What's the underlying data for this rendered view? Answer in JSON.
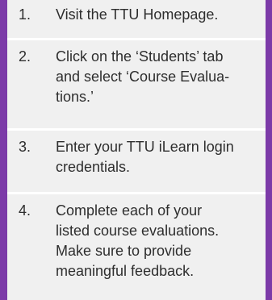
{
  "colors": {
    "border_accent": "#7c3aa8",
    "step_background": "#f0f0f0",
    "separator": "#ffffff",
    "text": "#2e2e2e"
  },
  "steps": [
    {
      "number": "1.",
      "text": "Visit the TTU Homepage."
    },
    {
      "number": "2.",
      "text": "Click on the ‘Students’ tab\nand select ‘Course Evalua-\ntions.’"
    },
    {
      "number": "3.",
      "text": "Enter your TTU iLearn login\ncredentials."
    },
    {
      "number": "4.",
      "text": "Complete each of your\nlisted course evaluations.\nMake sure to provide\nmeaningful feedback."
    }
  ]
}
